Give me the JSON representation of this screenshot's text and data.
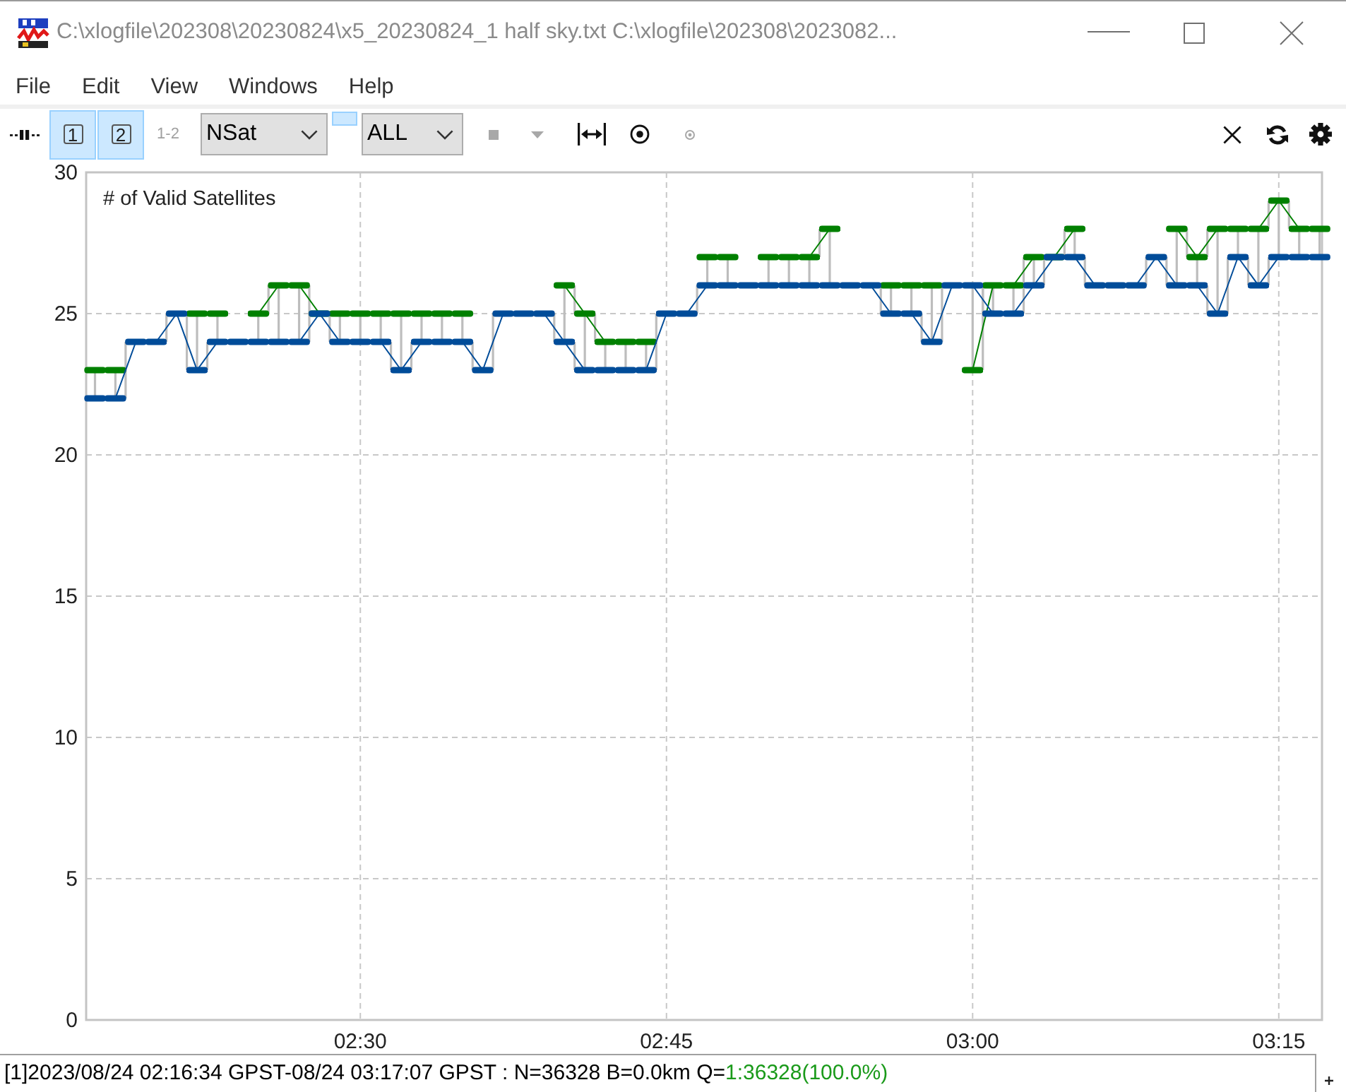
{
  "window": {
    "title": "C:\\xlogfile\\202308\\20230824\\x5_20230824_1 half sky.txt C:\\xlogfile\\202308\\2023082..."
  },
  "menu": [
    "File",
    "Edit",
    "View",
    "Windows",
    "Help"
  ],
  "toolbar": {
    "plot_buttons": [
      {
        "label": "1",
        "kind": "boxed",
        "selected": true,
        "disabled": false
      },
      {
        "label": "2",
        "kind": "boxed",
        "selected": true,
        "disabled": false
      },
      {
        "label": "1-2",
        "kind": "plain",
        "selected": false,
        "disabled": true
      }
    ],
    "plot_type": {
      "value": "NSat"
    },
    "mini_button": {
      "selected": true
    },
    "satellite_filter": {
      "value": "ALL"
    },
    "icon_buttons": [
      {
        "disabled": true
      },
      {
        "disabled": true
      },
      {
        "disabled": false
      },
      {
        "disabled": false
      },
      {
        "disabled": true
      },
      {
        "disabled": false
      },
      {
        "disabled": false
      },
      {
        "disabled": false
      }
    ]
  },
  "plot": {
    "chart_data": {
      "type": "line",
      "title": "# of Valid Satellites",
      "grid": true,
      "categories": [
        null,
        null,
        null,
        null,
        null,
        null,
        null,
        null,
        null,
        null,
        null,
        null,
        null,
        "02:30",
        null,
        null,
        null,
        null,
        null,
        null,
        null,
        null,
        null,
        null,
        null,
        null,
        null,
        null,
        "02:45",
        null,
        null,
        null,
        null,
        null,
        null,
        null,
        null,
        null,
        null,
        null,
        null,
        null,
        null,
        "03:00",
        null,
        null,
        null,
        null,
        null,
        null,
        null,
        null,
        null,
        null,
        null,
        null,
        null,
        null,
        "03:15",
        null,
        null
      ],
      "ylim": [
        0,
        30
      ],
      "yticks": [
        0,
        5,
        10,
        15,
        20,
        25,
        30
      ],
      "series": [
        {
          "color": "#008000",
          "values": [
            23,
            23,
            null,
            null,
            null,
            25,
            25,
            null,
            25,
            26,
            26,
            25,
            25,
            25,
            25,
            25,
            25,
            25,
            25,
            null,
            null,
            null,
            null,
            26,
            25,
            24,
            24,
            24,
            null,
            null,
            27,
            27,
            null,
            27,
            27,
            27,
            28,
            null,
            null,
            26,
            26,
            26,
            null,
            23,
            26,
            26,
            27,
            27,
            28,
            null,
            null,
            null,
            null,
            28,
            27,
            28,
            28,
            28,
            29,
            28,
            28
          ]
        },
        {
          "color": "#004c99",
          "values": [
            22,
            22,
            24,
            24,
            25,
            23,
            24,
            24,
            24,
            24,
            24,
            25,
            24,
            24,
            24,
            23,
            24,
            24,
            24,
            23,
            25,
            25,
            25,
            24,
            23,
            23,
            23,
            23,
            25,
            25,
            26,
            26,
            26,
            26,
            26,
            26,
            26,
            26,
            26,
            25,
            25,
            24,
            26,
            26,
            25,
            25,
            26,
            27,
            27,
            26,
            26,
            26,
            27,
            26,
            26,
            25,
            27,
            26,
            27,
            27,
            27
          ]
        }
      ]
    }
  },
  "status_bar": {
    "text": "[1]2023/08/24 02:16:34 GPST-08/24 03:17:07 GPST : N=36328 B=0.0km Q=",
    "quality": "1:36328(100.0%)"
  }
}
